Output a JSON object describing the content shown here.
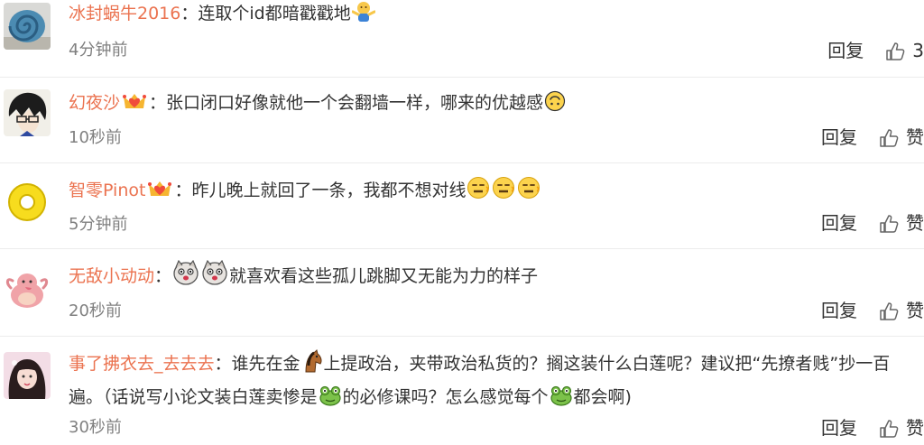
{
  "comments": [
    {
      "username": "冰封蜗牛2016",
      "colon": "：",
      "text": "连取个id都暗戳戳地",
      "time": "4分钟前",
      "reply_label": "回复",
      "like_label": "3",
      "avatar_icon": "snail-shell-avatar",
      "inline_icons": [
        "shrug-emoji"
      ]
    },
    {
      "username": "幻夜沙",
      "colon": "：",
      "text": "张口闭口好像就他一个会翻墙一样，哪来的优越感",
      "time": "10秒前",
      "reply_label": "回复",
      "like_label": "赞",
      "avatar_icon": "anime-glasses-avatar",
      "inline_icons": [
        "fan-badge",
        "upside-down-face-emoji"
      ]
    },
    {
      "username": "智零Pinot",
      "colon": "：",
      "text": "昨儿晚上就回了一条，我都不想对线",
      "time": "5分钟前",
      "reply_label": "回复",
      "like_label": "赞",
      "avatar_icon": "yellow-ring-avatar",
      "inline_icons": [
        "fan-badge",
        "zipper-face-emoji"
      ]
    },
    {
      "username": "无敌小动动",
      "colon": "：",
      "text": "就喜欢看这些孤儿跳脚又无能为力的样子",
      "time": "20秒前",
      "reply_label": "回复",
      "like_label": "赞",
      "avatar_icon": "pink-creature-avatar",
      "inline_icons": [
        "doge-emoji"
      ]
    },
    {
      "username": "事了拂衣去_去去去",
      "colon": "：",
      "text_parts": [
        "谁先在金",
        "上提政治，夹带政治私货的？搁这装什么白莲呢？建议把“先撩者贱”抄一百遍。（话说写小论文装白莲卖惨是",
        "的必修课吗？怎么感觉每个",
        "都会啊)"
      ],
      "time": "30秒前",
      "reply_label": "回复",
      "like_label": "赞",
      "avatar_icon": "girl-portrait-avatar",
      "inline_icons": [
        "horse-emoji",
        "frog-emoji"
      ]
    }
  ],
  "colors": {
    "username": "#eb7350",
    "text": "#333333",
    "meta": "#808080",
    "divider": "#ececec"
  }
}
